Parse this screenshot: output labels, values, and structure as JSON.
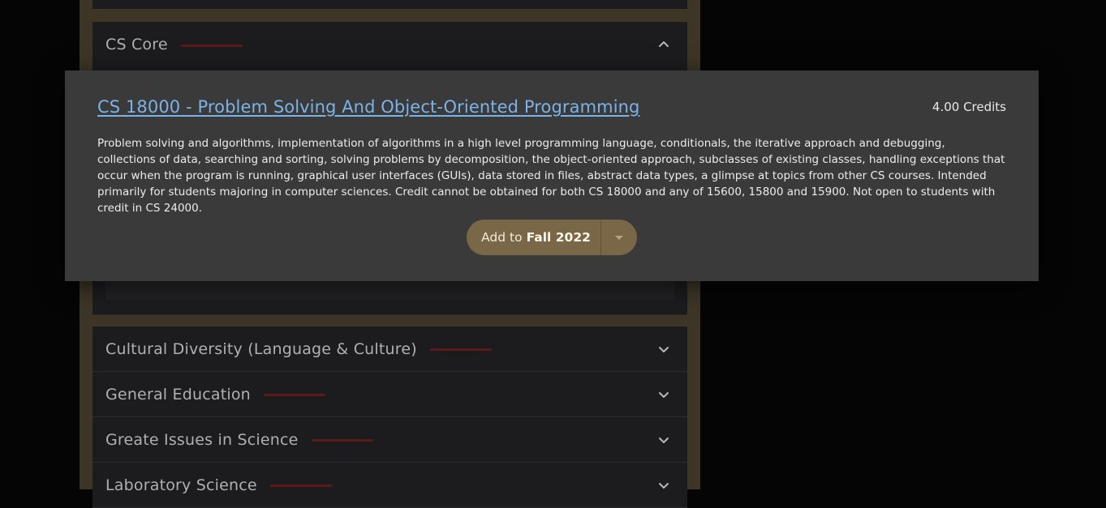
{
  "sections": [
    {
      "title": "CS Core",
      "expanded": true,
      "chevron": "chevron-up-icon"
    },
    {
      "title": "Cultural Diversity (Language & Culture)",
      "expanded": false,
      "chevron": "chevron-down-icon"
    },
    {
      "title": "General Education",
      "expanded": false,
      "chevron": "chevron-down-icon"
    },
    {
      "title": "Greate Issues in Science",
      "expanded": false,
      "chevron": "chevron-down-icon"
    },
    {
      "title": "Laboratory Science",
      "expanded": false,
      "chevron": "chevron-down-icon"
    }
  ],
  "modal": {
    "course_title": "CS 18000 - Problem Solving And Object-Oriented Programming",
    "credits": "4.00 Credits",
    "description": "Problem solving and algorithms, implementation of algorithms in a high level programming language, conditionals, the iterative approach and debugging, collections of data, searching and sorting, solving problems by decomposition, the object-oriented approach, subclasses of existing classes, handling exceptions that occur when the program is running, graphical user interfaces (GUIs), data stored in files, abstract data types, a glimpse at topics from other CS courses. Intended primarily for students majoring in computer sciences. Credit cannot be obtained for both CS 18000 and any of 15600, 15800 and 15900. Not open to students with credit in CS 24000.",
    "add_label": "Add to",
    "add_term": "Fall 2022"
  },
  "colors": {
    "link": "#7bb3e6",
    "add_button": "#7a6748",
    "panel_border": "#3d3526",
    "progress": "#5a1a1a"
  }
}
